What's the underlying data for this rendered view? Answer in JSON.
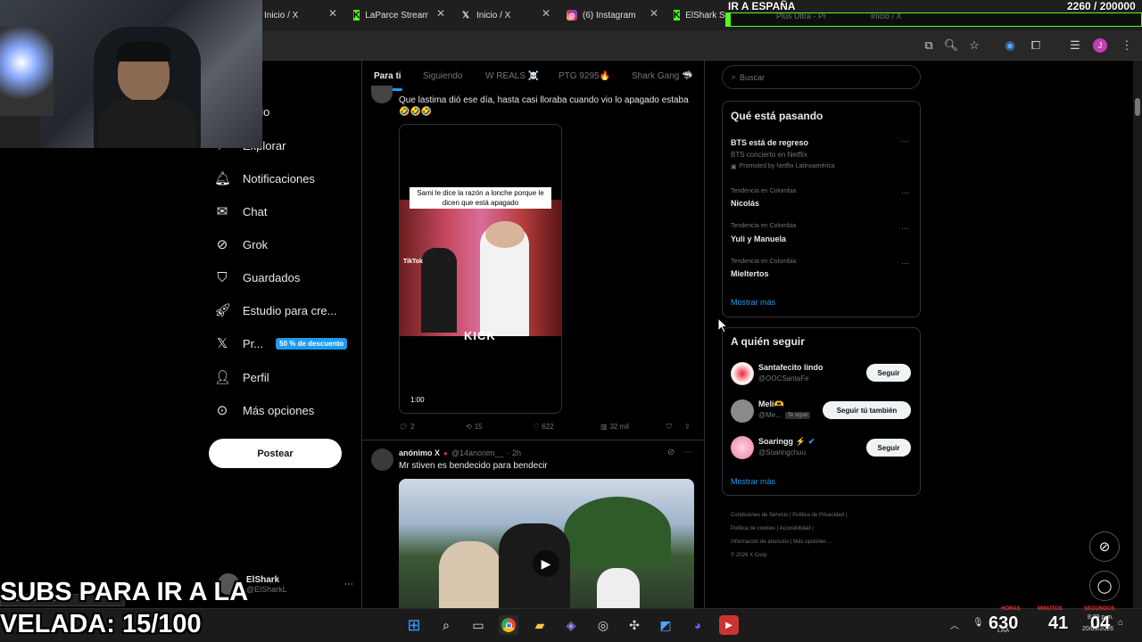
{
  "browser": {
    "tabs": [
      {
        "label": "Inicio / X",
        "icon": "x-icon"
      },
      {
        "label": "LaParce Stream",
        "icon": "kick-icon"
      },
      {
        "label": "Inicio / X",
        "icon": "x-icon"
      },
      {
        "label": "(6) Instagram",
        "icon": "instagram-icon"
      },
      {
        "label": "ElShark Stream",
        "icon": "kick-icon"
      },
      {
        "label": "Plus Ultra - Pr",
        "icon": "tab-icon"
      },
      {
        "label": "Inicio / X",
        "icon": "x-icon"
      }
    ]
  },
  "overlay": {
    "goal_title": "IR A ESPAÑA",
    "goal_counter": "2260 / 200000",
    "subs_text": "SUBS PARA IR A LA VELADA: 15/100",
    "status_url": "https://x.com/i/status/1..."
  },
  "nav": {
    "items": [
      {
        "label": "Inicio",
        "icon": "home-icon"
      },
      {
        "label": "Explorar",
        "icon": "search-icon"
      },
      {
        "label": "Notificaciones",
        "icon": "bell-icon"
      },
      {
        "label": "Chat",
        "icon": "mail-icon"
      },
      {
        "label": "Grok",
        "icon": "grok-icon"
      },
      {
        "label": "Guardados",
        "icon": "bookmark-icon"
      },
      {
        "label": "Estudio para cre...",
        "icon": "rocket-icon"
      },
      {
        "label": "Pr...",
        "icon": "x-logo-icon",
        "badge": "50 % de descuento"
      },
      {
        "label": "Perfil",
        "icon": "person-icon"
      },
      {
        "label": "Más opciones",
        "icon": "more-circle-icon"
      }
    ],
    "post_button": "Postear",
    "account": {
      "name": "ElShark",
      "handle": "@ElSharkL"
    }
  },
  "feed": {
    "tabs": [
      "Para ti",
      "Siguiendo",
      "W REALS ☠️",
      "PTG 9295🔥",
      "Shark Gang 🦈"
    ],
    "tweet1": {
      "text": "Que lastima dió ese día, hasta casi lloraba cuando vio lo apagado estaba 🤣🤣🤣",
      "video_caption": "Sami le dice la razón a lonche porque le dicen que está apagado",
      "video_brand": "KICK",
      "tiktok": "TikTok",
      "duration": "1:00",
      "replies": "2",
      "reposts": "15",
      "likes": "622",
      "views": "32 mil"
    },
    "tweet2": {
      "author": "anónimo X",
      "handle": "@14anonim__",
      "time": "· 2h",
      "text": "Mr stiven es bendecido para bendecir"
    }
  },
  "right": {
    "search_placeholder": "Buscar",
    "trends_title": "Qué está pasando",
    "promo": {
      "title": "BTS está de regreso",
      "subtitle": "BTS concierto en Netflix",
      "promoted": "Promoted by Netflix Latinoamérica"
    },
    "trends": [
      {
        "context": "Tendencia en Colombia",
        "name": "Nicolás"
      },
      {
        "context": "Tendencia en Colombia",
        "name": "Yuli y Manuela"
      },
      {
        "context": "Tendencia en Colombia",
        "name": "Mieltertos"
      }
    ],
    "show_more": "Mostrar más",
    "follow_title": "A quién seguir",
    "follow": [
      {
        "name": "Santafecito lindo",
        "handle": "@OOCSantaFe",
        "button": "Seguir"
      },
      {
        "name": "Meli🫶",
        "handle": "@Me...",
        "tag": "Te sigue",
        "button": "Seguir tú también"
      },
      {
        "name": "Soaringg ⚡",
        "handle": "@Soaringchuu",
        "button": "Seguir"
      }
    ],
    "show_more2": "Mostrar más",
    "footer": [
      "Condiciones de Servicio",
      "Política de Privacidad",
      "Política de cookies",
      "Accesibilidad",
      "Información de anuncios",
      "Más opciones ...",
      "© 2026 X Corp."
    ]
  },
  "taskbar": {
    "clock_time": "8:39 p.m.",
    "clock_date": "20/03/2026",
    "lang": "LAA",
    "stream_counters": {
      "hours": "6",
      "hours_label": "HORAS",
      "minutes": "30",
      "minutes_label": "MINUTOS",
      "extra": "41",
      "seconds": "04",
      "seconds_label": "SEGUNDOS"
    }
  }
}
